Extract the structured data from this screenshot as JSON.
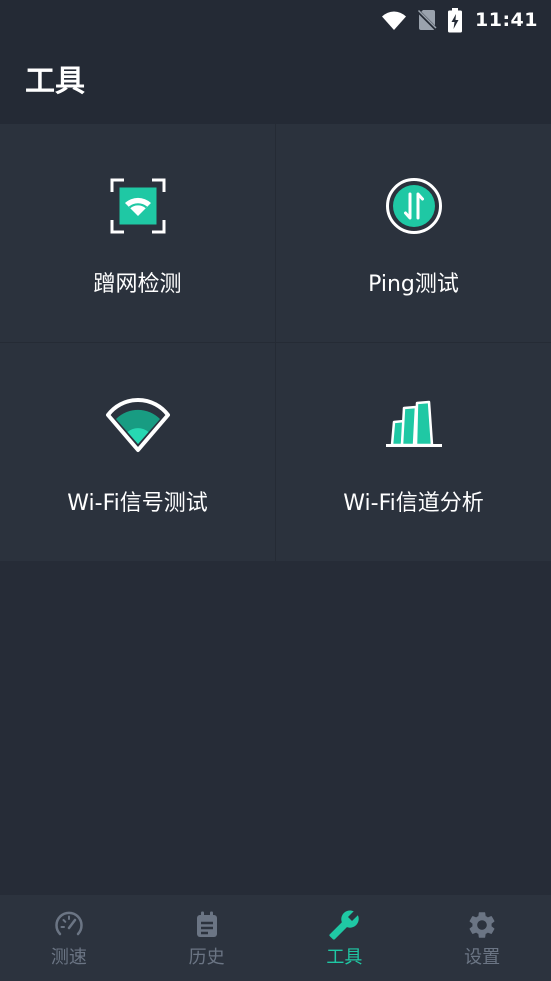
{
  "status_bar": {
    "time": "11:41",
    "icons": [
      "wifi-icon",
      "no-sim-icon",
      "battery-charging-icon"
    ]
  },
  "header": {
    "title": "工具"
  },
  "tools": [
    {
      "label": "蹭网检测",
      "icon": "wifi-scan-icon"
    },
    {
      "label": "Ping测试",
      "icon": "ping-icon"
    },
    {
      "label": "Wi-Fi信号测试",
      "icon": "wifi-signal-icon"
    },
    {
      "label": "Wi-Fi信道分析",
      "icon": "channel-analysis-icon"
    }
  ],
  "bottom_nav": {
    "items": [
      {
        "label": "测速",
        "icon": "speedometer-icon",
        "active": false
      },
      {
        "label": "历史",
        "icon": "history-notes-icon",
        "active": false
      },
      {
        "label": "工具",
        "icon": "wrench-icon",
        "active": true
      },
      {
        "label": "设置",
        "icon": "gear-icon",
        "active": false
      }
    ]
  },
  "colors": {
    "accent": "#1fc8a4",
    "accent_dark": "#189c82",
    "accent_light": "#27d8b2",
    "header_bg": "#242a35",
    "page_bg": "#262c37",
    "tile_bg": "#2b323d",
    "divider": "#252b35",
    "nav_bg": "#2c333e",
    "nav_inactive": "#6b7584",
    "text": "#ffffff"
  }
}
